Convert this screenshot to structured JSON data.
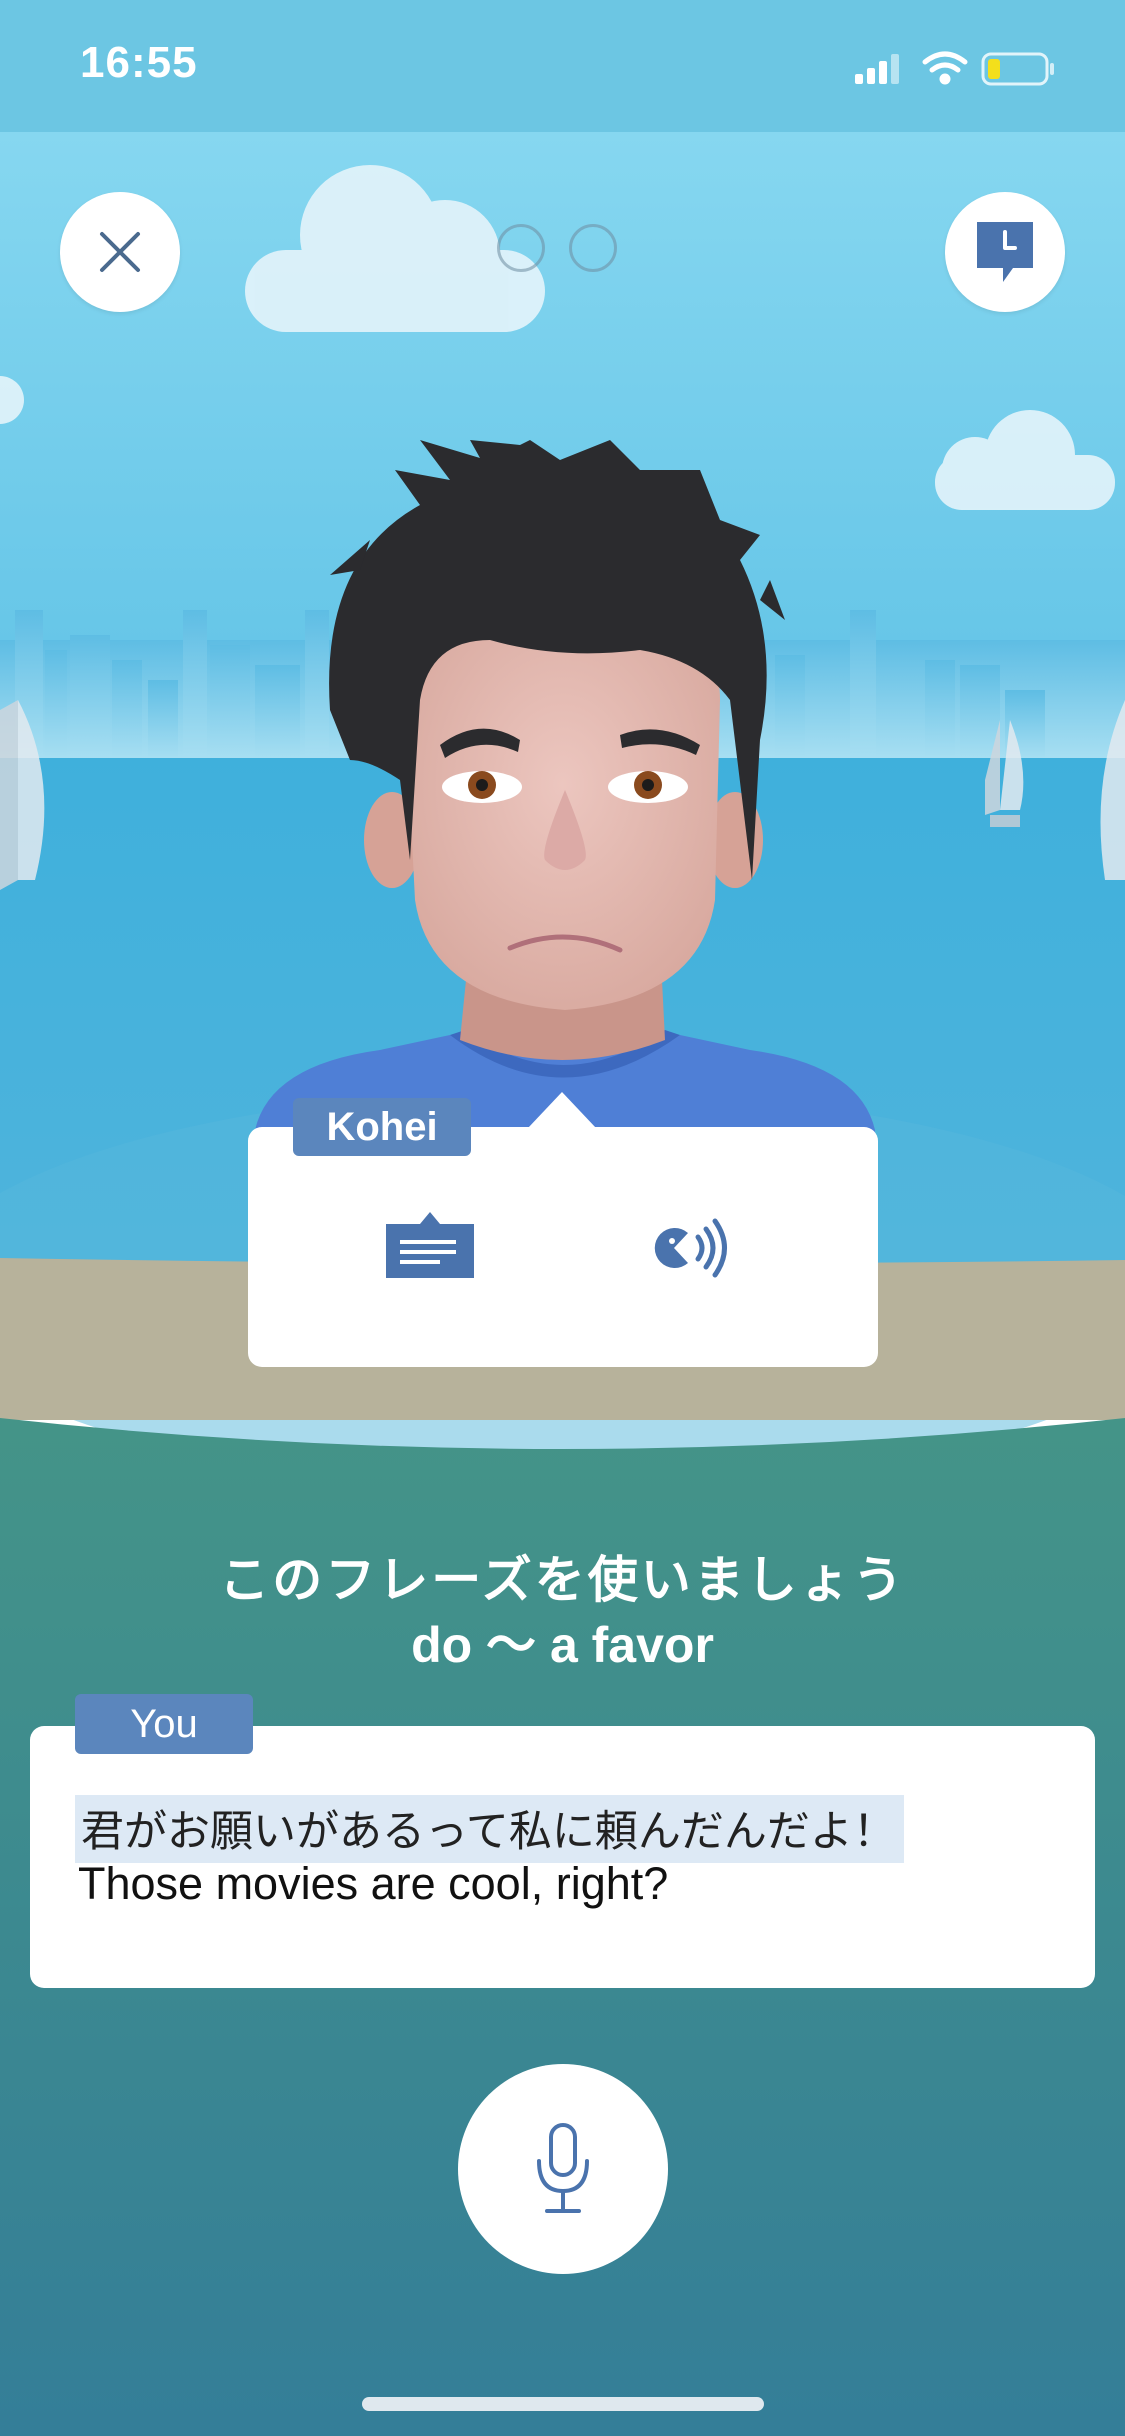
{
  "status_bar": {
    "time": "16:55"
  },
  "conversation": {
    "progress_dots": 2,
    "speaker": {
      "name": "Kohei"
    },
    "prompt": {
      "instruction": "このフレーズを使いましょう",
      "phrase": "do 〜 a favor"
    },
    "user": {
      "label": "You",
      "line_ja": "君がお願いがあるって私に頼んだんだよ！",
      "line_en": "Those movies are cool, right?"
    }
  },
  "icons": {
    "close": "close-icon",
    "history": "chat-clock-icon",
    "translate": "translate-card-icon",
    "audio": "speaker-audio-icon",
    "mic": "microphone-icon"
  },
  "colors": {
    "accent": "#5b86bd",
    "sky": "#7fcfea",
    "sea": "#49b1d9",
    "ground": "#3f8f88",
    "highlight": "#dde9f5"
  }
}
